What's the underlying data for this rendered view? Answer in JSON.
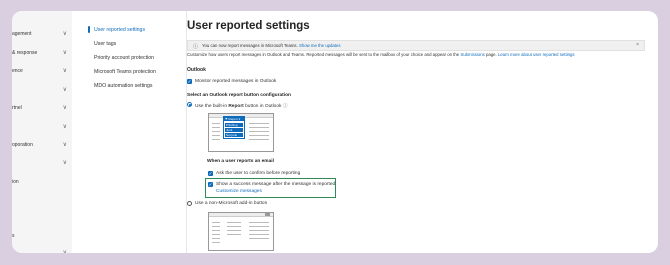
{
  "leftnav": {
    "items": [
      {
        "label": "agement",
        "chev": "∨"
      },
      {
        "label": "& response",
        "chev": "∨"
      },
      {
        "label": "ence",
        "chev": "∨"
      },
      {
        "label": "",
        "chev": "∨"
      },
      {
        "label": "rtnel",
        "chev": "∨"
      },
      {
        "label": "",
        "chev": "∨"
      },
      {
        "label": "oporation",
        "chev": "∨"
      },
      {
        "label": "",
        "chev": "∨"
      },
      {
        "label": "ion",
        "chev": ""
      },
      {
        "label": "",
        "chev": ""
      },
      {
        "label": "s",
        "chev": ""
      },
      {
        "label": "",
        "chev": "∨"
      }
    ]
  },
  "midnav": {
    "items": [
      {
        "label": "User reported settings",
        "active": true
      },
      {
        "label": "User tags",
        "active": false
      },
      {
        "label": "Priority account protection",
        "active": false
      },
      {
        "label": "Microsoft Teams protection",
        "active": false
      },
      {
        "label": "MDO automation settings",
        "active": false
      }
    ]
  },
  "main": {
    "title": "User reported settings",
    "banner": {
      "info_icon": "ⓘ",
      "text": "You can now report messages in Microsoft Teams. ",
      "link": "Show me the updates",
      "close": "×"
    },
    "desc": {
      "text": "Customize how users report messages in Outlook and Teams. Reported messages will be sent to the mailbox of your choice and appear on the ",
      "link1": "Submissions",
      "mid": " page. ",
      "link2": "Learn more about user reported settings"
    },
    "outlook_heading": "Outlook",
    "monitor_label": "Monitor reported messages in Outlook",
    "select_heading": "Select an Outlook report button configuration",
    "builtin_pre": "Use the built-in ",
    "builtin_bold": "Report",
    "builtin_post": " button in Outlook",
    "builtin_info": "ⓘ",
    "menu": {
      "header": "⚑ Report ∨",
      "items": [
        "Phishing",
        "Junk",
        "Not junk"
      ]
    },
    "when_heading": "When a user reports an email",
    "ask_label": "Ask the user to confirm before reporting",
    "show_label": "Show a success message after the message is reported",
    "customize_link": "Customize messages",
    "nonms_label": "Use a non-Microsoft add-in button"
  },
  "colors": {
    "accent": "#0f6cbd",
    "highlight_border": "#2e8b57",
    "background": "#d9cfe0"
  }
}
